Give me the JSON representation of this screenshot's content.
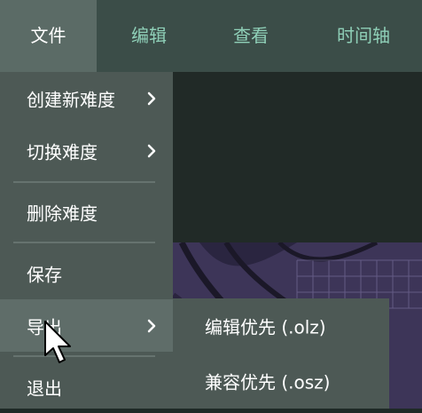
{
  "menubar": {
    "tabs": [
      {
        "label": "文件"
      },
      {
        "label": "编辑"
      },
      {
        "label": "查看"
      },
      {
        "label": "时间轴"
      }
    ]
  },
  "file_menu": {
    "items": [
      {
        "label": "创建新难度",
        "has_submenu": true
      },
      {
        "label": "切换难度",
        "has_submenu": true
      },
      {
        "label": "删除难度",
        "has_submenu": false
      },
      {
        "label": "保存",
        "has_submenu": false
      },
      {
        "label": "导出",
        "has_submenu": true,
        "highlighted": true
      },
      {
        "label": "退出",
        "has_submenu": false
      }
    ]
  },
  "export_submenu": {
    "items": [
      {
        "label": "编辑优先 (.olz)"
      },
      {
        "label": "兼容优先 (.osz)"
      }
    ]
  },
  "colors": {
    "menubar_bg": "#3b4d48",
    "active_tab_bg": "#5b6b66",
    "tab_text": "#8fd0b8",
    "menu_bg": "#4d5955",
    "menu_hover": "#5f6d69"
  }
}
